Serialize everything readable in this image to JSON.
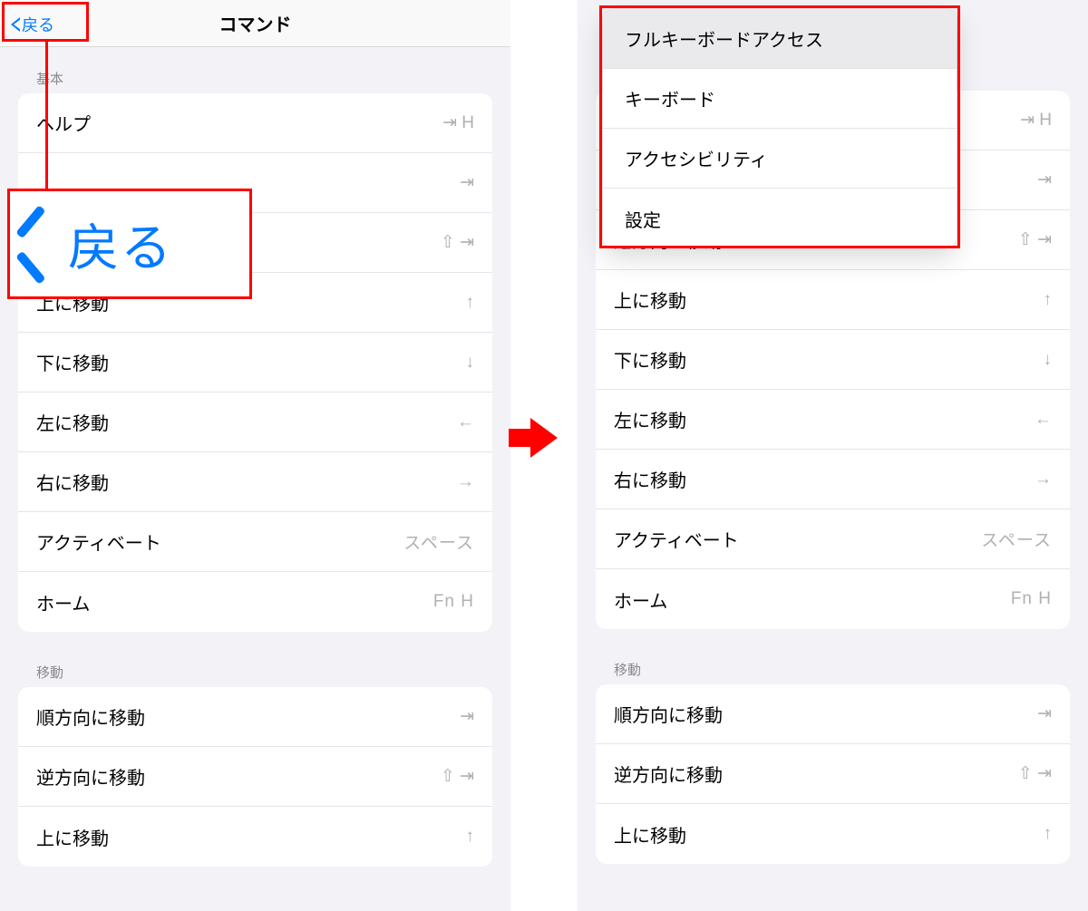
{
  "left": {
    "back_label": "戻る",
    "title": "コマンド",
    "callout_text": "戻る",
    "section1_header": "基本",
    "section2_header": "移動",
    "basic_rows": [
      {
        "label": "ヘルプ",
        "shortcut": "⇥ H"
      },
      {
        "label": "",
        "shortcut": "⇥"
      },
      {
        "label": "",
        "shortcut": "⇧ ⇥"
      },
      {
        "label": "上に移動",
        "shortcut": "↑"
      },
      {
        "label": "下に移動",
        "shortcut": "↓"
      },
      {
        "label": "左に移動",
        "shortcut": "←"
      },
      {
        "label": "右に移動",
        "shortcut": "→"
      },
      {
        "label": "アクティベート",
        "shortcut": "スペース"
      },
      {
        "label": "ホーム",
        "shortcut": "Fn H"
      }
    ],
    "move_rows": [
      {
        "label": "順方向に移動",
        "shortcut": "⇥"
      },
      {
        "label": "逆方向に移動",
        "shortcut": "⇧ ⇥"
      },
      {
        "label": "上に移動",
        "shortcut": "↑"
      }
    ]
  },
  "right": {
    "popover_items": [
      "フルキーボードアクセス",
      "キーボード",
      "アクセシビリティ",
      "設定"
    ],
    "section1_header": "",
    "section2_header": "移動",
    "visible_rows_top": [
      {
        "label": "",
        "shortcut": "⇥ H"
      },
      {
        "label": "",
        "shortcut": "⇥"
      },
      {
        "label": "逆方向に移動",
        "shortcut": "⇧ ⇥"
      },
      {
        "label": "上に移動",
        "shortcut": "↑"
      },
      {
        "label": "下に移動",
        "shortcut": "↓"
      },
      {
        "label": "左に移動",
        "shortcut": "←"
      },
      {
        "label": "右に移動",
        "shortcut": "→"
      },
      {
        "label": "アクティベート",
        "shortcut": "スペース"
      },
      {
        "label": "ホーム",
        "shortcut": "Fn H"
      }
    ],
    "move_rows": [
      {
        "label": "順方向に移動",
        "shortcut": "⇥"
      },
      {
        "label": "逆方向に移動",
        "shortcut": "⇧ ⇥"
      },
      {
        "label": "上に移動",
        "shortcut": "↑"
      }
    ]
  }
}
